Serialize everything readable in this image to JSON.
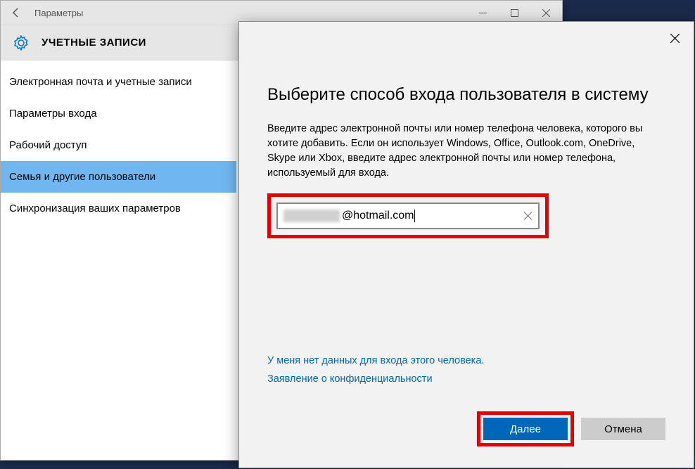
{
  "settings": {
    "window_title": "Параметры",
    "section_title": "УЧЕТНЫЕ ЗАПИСИ",
    "nav_items": [
      "Электронная почта и учетные записи",
      "Параметры входа",
      "Рабочий доступ",
      "Семья и другие пользователи",
      "Синхронизация ваших параметров"
    ],
    "active_nav_index": 3
  },
  "dialog": {
    "title": "Выберите способ входа пользователя в систему",
    "description": "Введите адрес электронной почты или номер телефона человека, которого вы хотите добавить. Если он использует Windows, Office, Outlook.com, OneDrive, Skype или Xbox, введите адрес электронной почты или номер телефона, используемый для входа.",
    "email_visible_part": "@hotmail.com",
    "link_no_credentials": "У меня нет данных для входа этого человека.",
    "link_privacy": "Заявление о конфиденциальности",
    "btn_next": "Далее",
    "btn_cancel": "Отмена"
  }
}
